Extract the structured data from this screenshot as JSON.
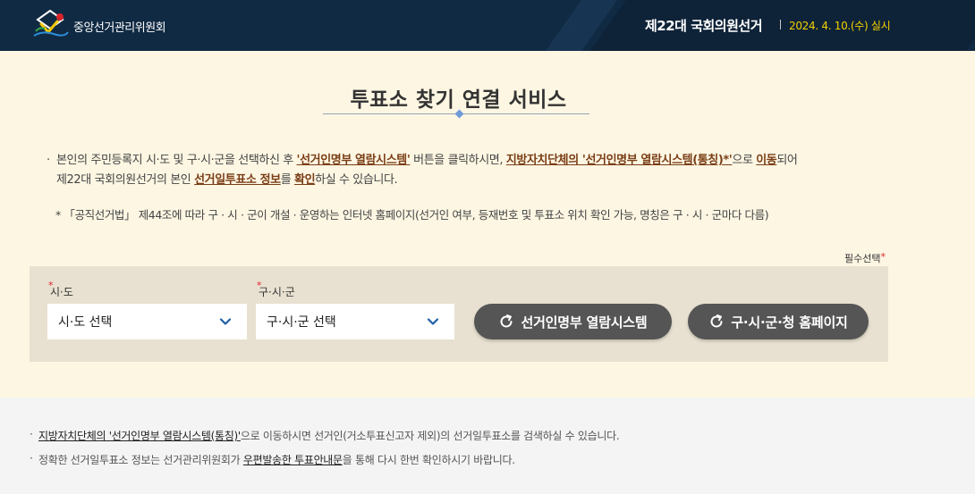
{
  "header": {
    "org_name": "중앙선거관리위원회",
    "election_title": "제22대 국회의원선거",
    "election_date": "2024. 4. 10.(수) 실시"
  },
  "main": {
    "page_title": "투표소 찾기 연결 서비스",
    "desc": {
      "bullet": "·",
      "p1": "본인의 주민등록지 시·도 및 구·시·군을 선택하신 후 ",
      "h1": "'선거인명부 열람시스템'",
      "p2": " 버튼을 클릭하시면, ",
      "h2": "지방자치단체의 '선거인명부 열람시스템(통칭)*'",
      "p3": "으로 ",
      "h3": "이동",
      "p4": "되어",
      "p5": "제22대 국회의원선거의 본인 ",
      "h4": "선거일투표소 정보",
      "p6": "를 ",
      "h5": "확인",
      "p7": "하실 수 있습니다."
    },
    "note": "* 「공직선거법」 제44조에 따라 구 · 시 · 군이 개설 · 운영하는 인터넷 홈페이지(선거인 여부, 등재번호 및 투표소 위치 확인 가능, 명칭은 구 · 시 · 군마다 다름)",
    "required_label": "필수선택",
    "required_star": "*",
    "sido": {
      "label": "시·도",
      "star": "*",
      "value": "시·도 선택"
    },
    "gusigun": {
      "label": "구·시·군",
      "star": "*",
      "value": "구·시·군 선택"
    },
    "btn_registry": "선거인명부 열람시스템",
    "btn_homepage": "구·시·군·청 홈페이지"
  },
  "footer": {
    "bullet": "·",
    "l1_link": "지방자치단체의 '선거인명부 열람시스템(통칭)'",
    "l1_rest": "으로 이동하시면 선거인(거소투표신고자 제외)의 선거일투표소를 검색하실 수 있습니다.",
    "l2_pre": "정확한 선거일투표소 정보는 선거관리위원회가 ",
    "l2_link": "우편발송한 투표안내문",
    "l2_rest": "을 통해 다시 한번 확인하시기 바랍니다."
  },
  "colors": {
    "header_bg": "#102a43",
    "accent_yellow": "#f3d200",
    "highlight_brown": "#7a3e16",
    "main_bg": "#fdf6e3",
    "panel_bg": "#e8e1d1",
    "button_bg": "#555555",
    "chevron_blue": "#1f5fa8",
    "required_red": "#e0242b"
  },
  "icons": [
    "nec-logo-icon",
    "chevron-down-icon",
    "refresh-icon"
  ]
}
